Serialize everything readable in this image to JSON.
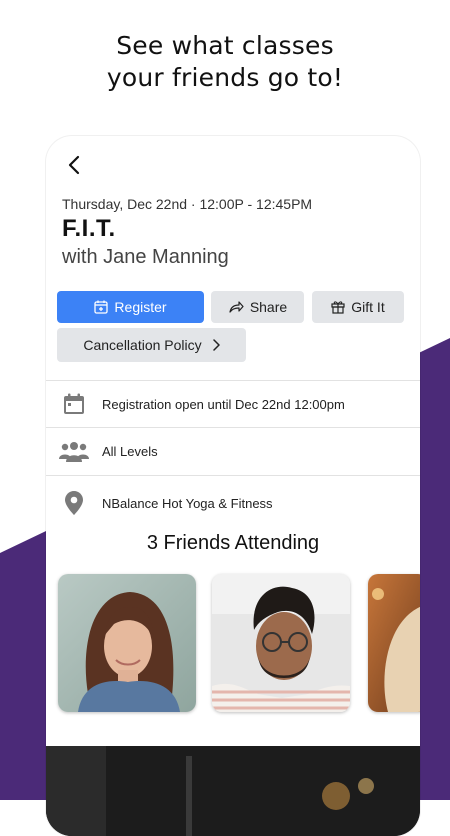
{
  "promo": {
    "headline_line1": "See what classes",
    "headline_line2": "your friends go to!"
  },
  "colors": {
    "accent": "#3c82f6",
    "purple_background": "#4b2a78",
    "secondary_button": "#e3e5e8"
  },
  "class_detail": {
    "datetime": "Thursday, Dec 22nd · 12:00P - 12:45PM",
    "title": "F.I.T.",
    "instructor": "with Jane Manning"
  },
  "actions": {
    "register_label": "Register",
    "share_label": "Share",
    "gift_label": "Gift It",
    "cancellation_label": "Cancellation Policy"
  },
  "info": {
    "registration": "Registration open until Dec 22nd 12:00pm",
    "level": "All Levels",
    "location": "NBalance Hot Yoga & Fitness"
  },
  "friends": {
    "heading": "3 Friends Attending",
    "count": 3
  },
  "icons": [
    "back-chevron-icon",
    "calendar-plus-icon",
    "share-arrow-icon",
    "gift-icon",
    "chevron-right-icon",
    "calendar-icon",
    "people-icon",
    "location-pin-icon"
  ]
}
